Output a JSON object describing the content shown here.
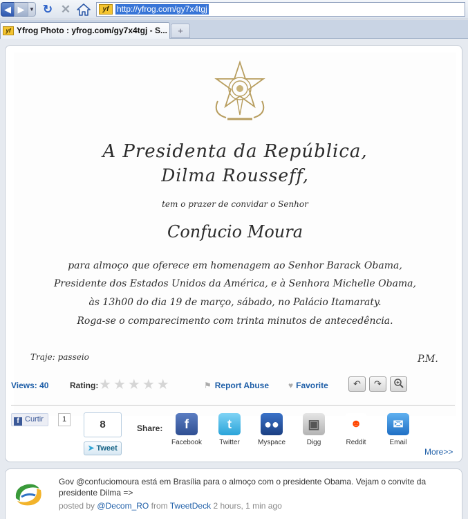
{
  "browser": {
    "url": "http://yfrog.com/gy7x4tgj",
    "favicon_text": "yf",
    "tab_title": "Yfrog Photo : yfrog.com/gy7x4tgj - S...",
    "new_tab": "+"
  },
  "invitation": {
    "line1": "A Presidenta da República,",
    "line2": "Dilma Rousseff,",
    "line3": "tem o prazer de convidar o Senhor",
    "line4": "Confucio Moura",
    "line5": "para almoço que oferece em homenagem ao Senhor Barack Obama,",
    "line6": "Presidente dos Estados Unidos da América, e à Senhora Michelle Obama,",
    "line7": "às 13h00 do dia 19 de março, sábado, no Palácio Itamaraty.",
    "line8": "Roga-se o comparecimento com trinta minutos de antecedência.",
    "dress": "Traje: passeio",
    "rsvp": "P.M."
  },
  "stats": {
    "views": "Views: 40",
    "rating_label": "Rating:",
    "rating_value": 0,
    "report_abuse": "Report Abuse",
    "favorite": "Favorite"
  },
  "social": {
    "curtir_label": "Curtir",
    "curtir_count": "1",
    "tweet_count": "8",
    "tweet_button": "Tweet",
    "share_label": "Share:",
    "facebook": "Facebook",
    "twitter": "Twitter",
    "myspace": "Myspace",
    "digg": "Digg",
    "reddit": "Reddit",
    "email": "Email",
    "more": "More>>"
  },
  "tweet": {
    "text": "Gov @confuciomoura está em Brasília para o almoço com o presidente Obama. Vejam o convite da presidente Dilma =>",
    "posted_by": "posted by",
    "author": "@Decom_RO",
    "from": "from",
    "client": "TweetDeck",
    "time": "2 hours, 1 min ago"
  },
  "colors": {
    "link": "#1f5fa8",
    "accent": "#3875d7"
  }
}
